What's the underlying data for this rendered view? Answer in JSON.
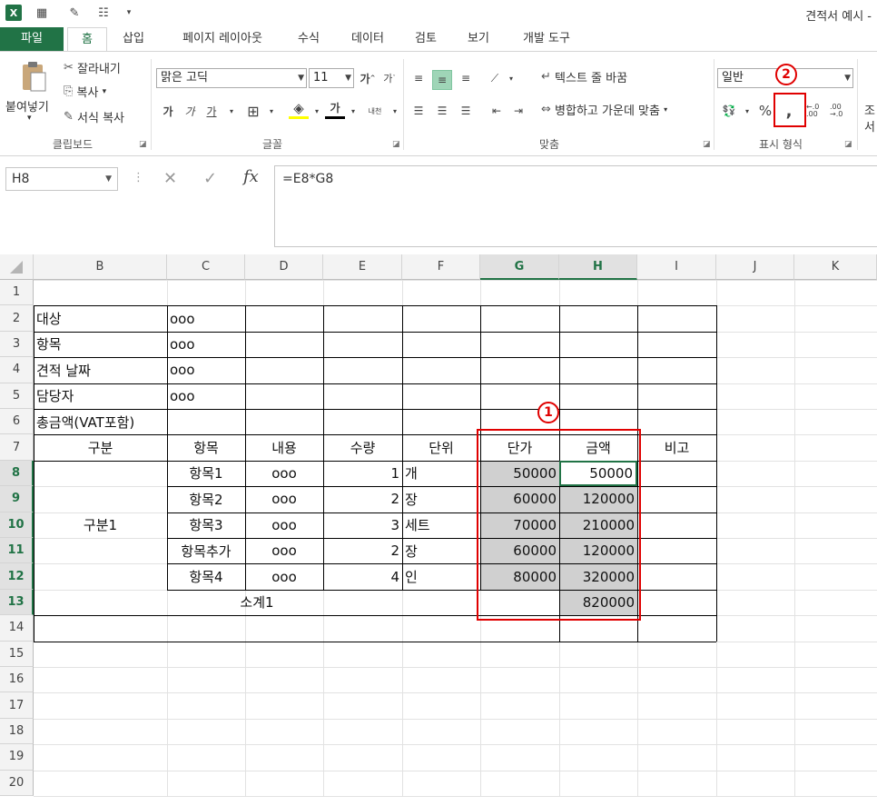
{
  "window": {
    "title": "견적서 예시 -"
  },
  "tabs": [
    {
      "label": "파일"
    },
    {
      "label": "홈"
    },
    {
      "label": "삽입"
    },
    {
      "label": "페이지 레이아웃"
    },
    {
      "label": "수식"
    },
    {
      "label": "데이터"
    },
    {
      "label": "검토"
    },
    {
      "label": "보기"
    },
    {
      "label": "개발 도구"
    }
  ],
  "ribbon": {
    "clipboard": {
      "paste": "붙여넣기",
      "cut": "잘라내기",
      "copy": "복사",
      "format_painter": "서식 복사",
      "group": "클립보드"
    },
    "font": {
      "name": "맑은 고딕",
      "size": "11",
      "bold": "가",
      "italic": "가",
      "underline": "가",
      "grow": "가",
      "shrink": "가",
      "phonetic": "내천",
      "group": "글꼴"
    },
    "align": {
      "wrap": "텍스트 줄 바꿈",
      "merge": "병합하고 가운데 맞춤",
      "group": "맞춤"
    },
    "number": {
      "format": "일반",
      "percent": "%",
      "comma": ",",
      "inc_dec": "←.0 .00",
      "dec_dec": ".00 →.0",
      "group": "표시 형식"
    },
    "styles": {
      "cond_top": "조",
      "cond_bottom": "서"
    }
  },
  "formula_bar": {
    "name_box": "H8",
    "cancel": "✕",
    "enter": "✓",
    "fx": "fx",
    "formula": "=E8*G8"
  },
  "columns": [
    "B",
    "C",
    "D",
    "E",
    "F",
    "G",
    "H",
    "I",
    "J",
    "K"
  ],
  "rows": [
    "1",
    "2",
    "3",
    "4",
    "5",
    "6",
    "7",
    "8",
    "9",
    "10",
    "11",
    "12",
    "13",
    "14",
    "15",
    "16",
    "17",
    "18",
    "19",
    "20"
  ],
  "cells": {
    "info": [
      {
        "label": "대상",
        "value": "ooo"
      },
      {
        "label": "항목",
        "value": "ooo"
      },
      {
        "label": "견적 날짜",
        "value": "ooo"
      },
      {
        "label": "담당자",
        "value": "ooo"
      },
      {
        "label": "총금액(VAT포함)",
        "value": ""
      }
    ],
    "header": {
      "b": "구분",
      "c": "항목",
      "d": "내용",
      "e": "수량",
      "f": "단위",
      "g": "단가",
      "h": "금액",
      "i": "비고"
    },
    "group_label": "구분1",
    "items": [
      {
        "item": "항목1",
        "content": "ooo",
        "qty": "1",
        "unit": "개",
        "price": "50000",
        "amount": "50000"
      },
      {
        "item": "항목2",
        "content": "ooo",
        "qty": "2",
        "unit": "장",
        "price": "60000",
        "amount": "120000"
      },
      {
        "item": "항목3",
        "content": "ooo",
        "qty": "3",
        "unit": "세트",
        "price": "70000",
        "amount": "210000"
      },
      {
        "item": "항목추가",
        "content": "ooo",
        "qty": "2",
        "unit": "장",
        "price": "60000",
        "amount": "120000"
      },
      {
        "item": "항목4",
        "content": "ooo",
        "qty": "4",
        "unit": "인",
        "price": "80000",
        "amount": "320000"
      }
    ],
    "subtotal": {
      "label": "소계1",
      "amount": "820000"
    }
  },
  "annotations": {
    "badge1": "1",
    "badge2": "2"
  },
  "colors": {
    "excel_green": "#217346",
    "annotation_red": "#e00000",
    "selection_fill": "#d0d0d0"
  }
}
